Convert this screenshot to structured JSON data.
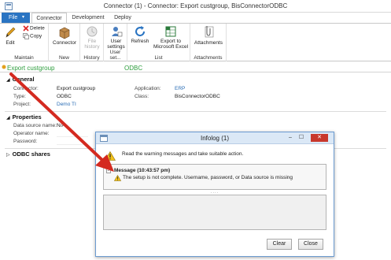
{
  "window": {
    "title": "Connector (1) - Connector: Export custgroup, BisConnectorODBC"
  },
  "ribbon_tabs": {
    "file": "File",
    "file_caret": "▾",
    "connector": "Connector",
    "development": "Development",
    "deploy": "Deploy"
  },
  "ribbon": {
    "maintain": {
      "edit": "Edit",
      "delete": "Delete",
      "copy": "Copy",
      "label": "Maintain"
    },
    "new": {
      "connector": "Connector",
      "label": "New"
    },
    "history": {
      "file_history_1": "File",
      "file_history_2": "history",
      "label": "History"
    },
    "user_setup": {
      "user_settings_1": "User",
      "user_settings_2": "settings",
      "label": "User set..."
    },
    "list": {
      "refresh": "Refresh",
      "export_1": "Export to",
      "export_2": "Microsoft Excel",
      "label": "List"
    },
    "attachments": {
      "attachments": "Attachments",
      "label": "Attachments"
    }
  },
  "record": {
    "title": "Export custgroup",
    "subtitle": "ODBC"
  },
  "general": {
    "heading": "General",
    "connector_label": "Connector:",
    "connector_value": "Export custgroup",
    "type_label": "Type:",
    "type_value": "ODBC",
    "project_label": "Project:",
    "project_value": "Demo TI",
    "application_label": "Application:",
    "application_value": "ERP",
    "class_label": "Class:",
    "class_value": "BisConnectorODBC"
  },
  "properties": {
    "heading": "Properties",
    "dsn_label": "Data source name:",
    "dsn_value": "N/A",
    "operator_label": "Operator name:",
    "password_label": "Password:"
  },
  "odbc_shares": {
    "heading": "ODBC shares"
  },
  "infolog": {
    "title": "Infolog (1)",
    "warning_text": "Read the warning messages and take suitable action.",
    "message_header": "Message (10:43:57 pm)",
    "message_body": "The setup is not complete. Username, password, or Data source is missing",
    "dots": "....",
    "clear": "Clear",
    "close": "Close",
    "minimize": "–",
    "maximize": "☐",
    "close_x": "✕"
  },
  "colors": {
    "accent": "#2a74c2",
    "record_green": "#2e9e3e",
    "arrow_red": "#d42a20",
    "link": "#2a6db5"
  }
}
